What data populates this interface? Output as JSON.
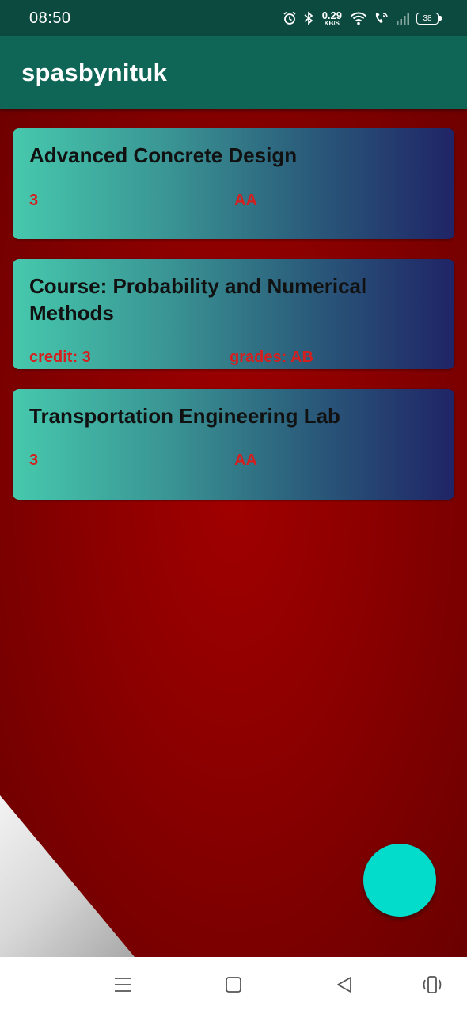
{
  "status_bar": {
    "time": "08:50",
    "speed_value": "0.29",
    "speed_unit": "KB/S",
    "battery": "38",
    "icons": [
      "alarm-icon",
      "bluetooth-icon",
      "wifi-icon",
      "wifi-calling-icon",
      "signal-icon",
      "battery-icon"
    ]
  },
  "app_bar": {
    "title": "spasbynituk"
  },
  "courses": [
    {
      "name": "Advanced Concrete Design",
      "credit": "3",
      "grade": "AA"
    },
    {
      "name": "Course: Probability and Numerical Methods",
      "credit": "credit: 3",
      "grade": "grades: AB"
    },
    {
      "name": "Transportation Engineering Lab",
      "credit": "3",
      "grade": "AA"
    }
  ],
  "fab": {
    "icon": "none"
  },
  "nav_bar": {
    "buttons": [
      "menu-icon",
      "home-icon",
      "back-icon",
      "rotate-icon"
    ]
  },
  "colors": {
    "status_bar": "#0c4a3f",
    "app_bar": "#0f6656",
    "background": "#8a0000",
    "card_start": "#46c9ad",
    "card_end": "#1f2466",
    "detail_text": "#d51f1f",
    "fab": "#03dccb"
  }
}
